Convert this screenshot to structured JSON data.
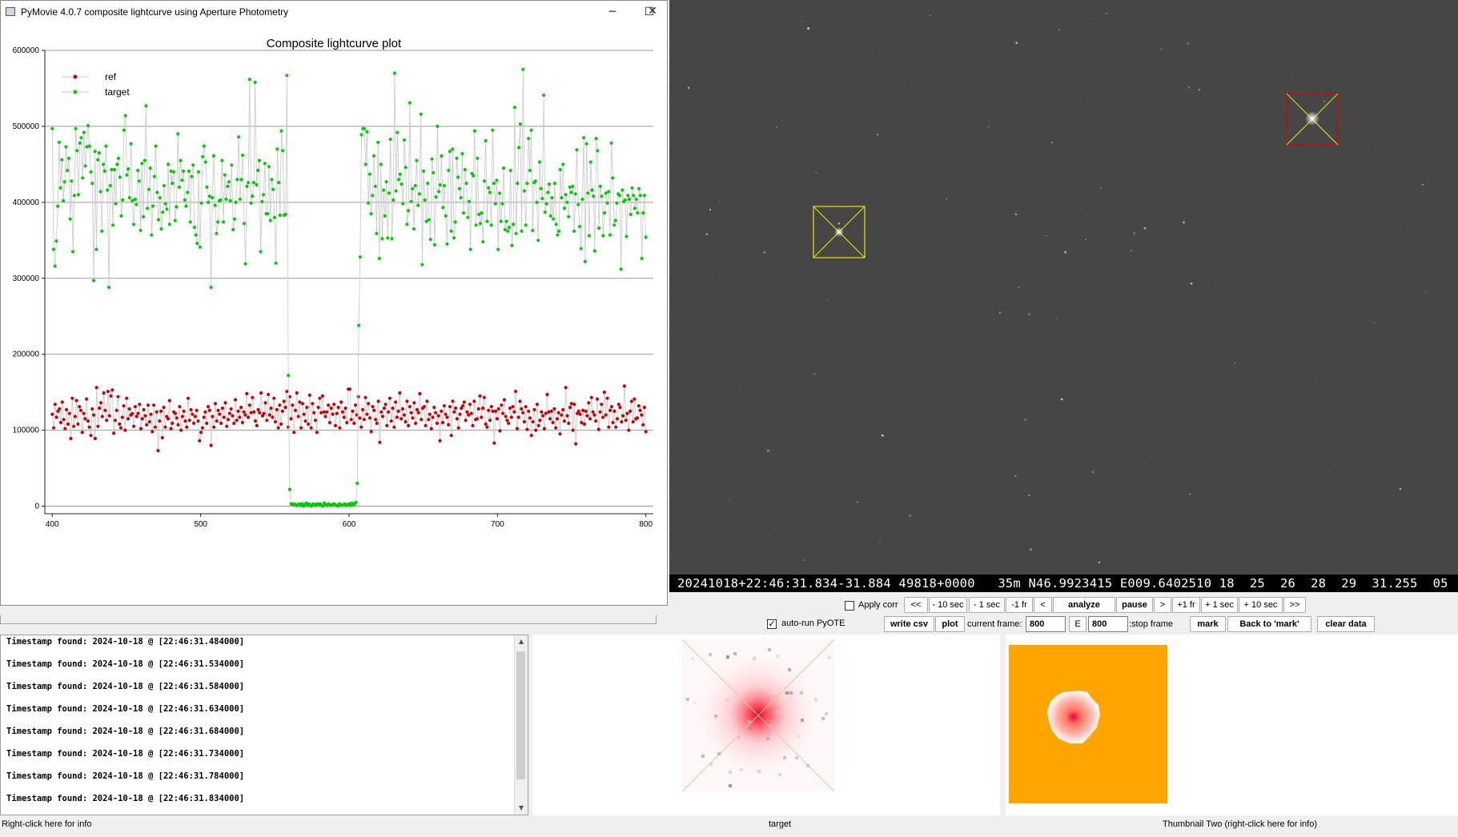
{
  "window": {
    "title": "PyMovie 4.0.7 composite lightcurve using Aperture Photometry",
    "minimize_glyph": "─",
    "maximize_glyph": "☐",
    "close_glyph": "✕"
  },
  "chart_data": {
    "type": "scatter",
    "title": "Composite lightcurve plot",
    "xlabel": "",
    "ylabel": "",
    "xlim": [
      395,
      805
    ],
    "ylim": [
      -10000,
      600000
    ],
    "x_ticks": [
      "400",
      "500",
      "600",
      "700",
      "800"
    ],
    "y_ticks": [
      "0",
      "100000",
      "200000",
      "300000",
      "400000",
      "500000",
      "600000"
    ],
    "grid": true,
    "legend_position": "top-left",
    "series": [
      {
        "name": "ref",
        "color": "#cc0000",
        "x_start": 400,
        "x_end": 800,
        "values": [
          121000,
          103000,
          134000,
          117000,
          125000,
          128000,
          110000,
          137000,
          114000,
          102000,
          127000,
          108000,
          122000,
          89000,
          142000,
          105000,
          118000,
          139000,
          108000,
          131000,
          126000,
          97000,
          122000,
          115000,
          141000,
          112000,
          104000,
          93000,
          128000,
          120000,
          89000,
          156000,
          105000,
          129000,
          136000,
          118000,
          149000,
          126000,
          113000,
          151000,
          119000,
          145000,
          153000,
          96000,
          113000,
          126000,
          144000,
          108000,
          103000,
          117000,
          132000,
          100000,
          142000,
          115000,
          128000,
          120000,
          122000,
          105000,
          131000,
          118000,
          122000,
          134000,
          102000,
          115000,
          127000,
          119000,
          107000,
          133000,
          111000,
          121000,
          98000,
          133000,
          104000,
          124000,
          73000,
          112000,
          125000,
          90000,
          130000,
          104000,
          118000,
          115000,
          139000,
          102000,
          109000,
          124000,
          122000,
          116000,
          107000,
          131000,
          100000,
          118000,
          125000,
          112000,
          104000,
          142000,
          113000,
          127000,
          121000,
          109000,
          118000,
          126000,
          112000,
          86000,
          97000,
          103000,
          117000,
          124000,
          109000,
          131000,
          126000,
          80000,
          118000,
          104000,
          135000,
          112000,
          126000,
          121000,
          109000,
          129000,
          117000,
          136000,
          105000,
          114000,
          122000,
          128000,
          119000,
          109000,
          140000,
          113000,
          125000,
          117000,
          130000,
          110000,
          124000,
          120000,
          148000,
          117000,
          133000,
          123000,
          143000,
          124000,
          112000,
          106000,
          127000,
          123000,
          149000,
          119000,
          122000,
          136000,
          113000,
          147000,
          120000,
          129000,
          117000,
          142000,
          111000,
          127000,
          103000,
          133000,
          108000,
          125000,
          138000,
          130000,
          151000,
          104000,
          144000,
          115000,
          133000,
          97000,
          126000,
          149000,
          118000,
          137000,
          103000,
          135000,
          121000,
          112000,
          130000,
          108000,
          146000,
          103000,
          135000,
          123000,
          113000,
          97000,
          130000,
          142000,
          123000,
          145000,
          124000,
          118000,
          124000,
          133000,
          110000,
          129000,
          121000,
          134000,
          106000,
          122000,
          130000,
          103000,
          137000,
          124000,
          117000,
          129000,
          110000,
          154000,
          154000,
          114000,
          125000,
          109000,
          133000,
          120000,
          144000,
          116000,
          104000,
          127000,
          114000,
          143000,
          121000,
          135000,
          116000,
          98000,
          131000,
          126000,
          114000,
          109000,
          138000,
          84000,
          124000,
          118000,
          129000,
          134000,
          106000,
          124000,
          142000,
          112000,
          129000,
          104000,
          137000,
          117000,
          125000,
          149000,
          115000,
          128000,
          120000,
          111000,
          138000,
          106000,
          131000,
          123000,
          116000,
          136000,
          109000,
          127000,
          123000,
          148000,
          114000,
          129000,
          131000,
          106000,
          138000,
          114000,
          121000,
          102000,
          117000,
          130000,
          123000,
          109000,
          119000,
          86000,
          125000,
          110000,
          132000,
          121000,
          117000,
          107000,
          131000,
          93000,
          138000,
          124000,
          129000,
          115000,
          103000,
          121000,
          129000,
          132000,
          137000,
          113000,
          124000,
          120000,
          134000,
          122000,
          106000,
          138000,
          114000,
          115000,
          128000,
          145000,
          117000,
          129000,
          143000,
          108000,
          104000,
          126000,
          113000,
          131000,
          125000,
          83000,
          125000,
          115000,
          128000,
          99000,
          133000,
          122000,
          140000,
          118000,
          113000,
          109000,
          129000,
          117000,
          131000,
          124000,
          151000,
          102000,
          117000,
          138000,
          128000,
          123000,
          111000,
          131000,
          101000,
          125000,
          116000,
          93000,
          111000,
          127000,
          100000,
          134000,
          106000,
          113000,
          124000,
          119000,
          102000,
          122000,
          147000,
          124000,
          115000,
          125000,
          110000,
          128000,
          103000,
          115000,
          123000,
          95000,
          120000,
          127000,
          112000,
          156000,
          119000,
          109000,
          130000,
          135000,
          100000,
          134000,
          82000,
          122000,
          125000,
          121000,
          110000,
          126000,
          108000,
          125000,
          119000,
          136000,
          115000,
          143000,
          124000,
          120000,
          112000,
          141000,
          101000,
          124000,
          134000,
          117000,
          150000,
          120000,
          142000,
          104000,
          126000,
          131000,
          110000,
          125000,
          104000,
          115000,
          134000,
          130000,
          111000,
          119000,
          158000,
          113000,
          122000,
          100000,
          125000,
          138000,
          111000,
          141000,
          115000,
          116000,
          132000,
          126000,
          120000,
          107000,
          130000,
          98000
        ]
      },
      {
        "name": "target",
        "color": "#00cc00",
        "x_start": 400,
        "x_end": 800,
        "values": [
          497000,
          338000,
          316000,
          349000,
          395000,
          479000,
          419000,
          456000,
          402000,
          427000,
          473000,
          442000,
          458000,
          378000,
          428000,
          335000,
          409000,
          497000,
          468000,
          410000,
          478000,
          485000,
          432000,
          492000,
          448000,
          473000,
          501000,
          474000,
          440000,
          425000,
          297000,
          467000,
          338000,
          456000,
          465000,
          414000,
          362000,
          450000,
          441000,
          474000,
          416000,
          288000,
          422000,
          443000,
          370000,
          443000,
          398000,
          450000,
          458000,
          433000,
          382000,
          403000,
          495000,
          514000,
          436000,
          444000,
          406000,
          477000,
          402000,
          371000,
          404000,
          397000,
          442000,
          428000,
          363000,
          451000,
          381000,
          455000,
          527000,
          392000,
          417000,
          445000,
          357000,
          395000,
          434000,
          474000,
          413000,
          377000,
          406000,
          365000,
          387000,
          422000,
          398000,
          391000,
          450000,
          371000,
          441000,
          425000,
          440000,
          376000,
          394000,
          490000,
          420000,
          455000,
          429000,
          441000,
          403000,
          395000,
          413000,
          441000,
          374000,
          434000,
          449000,
          367000,
          357000,
          346000,
          440000,
          341000,
          399000,
          460000,
          474000,
          453000,
          420000,
          400000,
          408000,
          288000,
          406000,
          461000,
          396000,
          359000,
          374000,
          402000,
          403000,
          455000,
          374000,
          436000,
          404000,
          421000,
          427000,
          402000,
          449000,
          364000,
          378000,
          400000,
          430000,
          486000,
          404000,
          430000,
          462000,
          372000,
          319000,
          421000,
          426000,
          562000,
          399000,
          408000,
          426000,
          558000,
          423000,
          442000,
          455000,
          335000,
          401000,
          410000,
          451000,
          385000,
          385000,
          447000,
          376000,
          430000,
          417000,
          380000,
          320000,
          470000,
          426000,
          383000,
          494000,
          468000,
          383000,
          384000,
          567000,
          172000,
          22000,
          3000,
          2000,
          3000,
          2000,
          1000,
          2000,
          3000,
          1000,
          3000,
          0,
          2000,
          4000,
          1000,
          3000,
          1000,
          0,
          3000,
          2000,
          1000,
          3000,
          2000,
          3000,
          1000,
          0,
          4000,
          2000,
          1000,
          3000,
          2000,
          1000,
          2000,
          3000,
          2000,
          1000,
          0,
          3000,
          2000,
          1000,
          2000,
          3000,
          1000,
          2000,
          3000,
          1000,
          4000,
          2000,
          3000,
          5000,
          30000,
          238000,
          328000,
          489000,
          497000,
          497000,
          450000,
          493000,
          399000,
          437000,
          385000,
          409000,
          461000,
          421000,
          359000,
          479000,
          326000,
          450000,
          352000,
          416000,
          382000,
          427000,
          353000,
          412000,
          483000,
          352000,
          403000,
          570000,
          415000,
          492000,
          430000,
          437000,
          424000,
          398000,
          482000,
          446000,
          371000,
          389000,
          531000,
          401000,
          418000,
          365000,
          422000,
          455000,
          396000,
          411000,
          516000,
          318000,
          441000,
          403000,
          375000,
          425000,
          377000,
          351000,
          457000,
          439000,
          344000,
          407000,
          500000,
          414000,
          423000,
          461000,
          393000,
          422000,
          382000,
          345000,
          442000,
          467000,
          362000,
          470000,
          353000,
          374000,
          458000,
          433000,
          418000,
          406000,
          464000,
          386000,
          443000,
          425000,
          380000,
          401000,
          338000,
          438000,
          435000,
          494000,
          370000,
          458000,
          384000,
          372000,
          386000,
          348000,
          428000,
          481000,
          375000,
          419000,
          413000,
          370000,
          495000,
          425000,
          398000,
          429000,
          338000,
          412000,
          375000,
          398000,
          445000,
          364000,
          375000,
          362000,
          367000,
          442000,
          343000,
          371000,
          525000,
          359000,
          425000,
          472000,
          503000,
          362000,
          575000,
          415000,
          370000,
          425000,
          484000,
          442000,
          495000,
          363000,
          426000,
          428000,
          400000,
          350000,
          453000,
          418000,
          405000,
          541000,
          387000,
          398000,
          413000,
          424000,
          382000,
          406000,
          378000,
          425000,
          371000,
          357000,
          362000,
          443000,
          406000,
          450000,
          392000,
          410000,
          400000,
          381000,
          420000,
          413000,
          421000,
          362000,
          411000,
          469000,
          397000,
          368000,
          339000,
          404000,
          485000,
          322000,
          477000,
          412000,
          356000,
          453000,
          416000,
          408000,
          336000,
          484000,
          468000,
          366000,
          421000,
          408000,
          356000,
          386000,
          412000,
          399000,
          414000,
          357000,
          478000,
          432000,
          370000,
          376000,
          399000,
          411000,
          409000,
          312000,
          416000,
          401000,
          403000,
          355000,
          409000,
          404000,
          384000,
          419000,
          409000,
          392000,
          404000,
          386000,
          418000,
          409000,
          326000,
          386000,
          409000,
          354000
        ]
      }
    ]
  },
  "starfield": {
    "osd_text": "20241018+22:46:31.834-31.884 49818+0000   35m N46.9923415 E009.6402510 18  25  26  28  29  31.255  05",
    "background_color": "#3a3a3a",
    "target_aperture_color": "#ffff00",
    "ref_aperture_color": "#ff0000"
  },
  "controls": {
    "apply_corr": {
      "label": "Apply corr",
      "checked": false
    },
    "auto_run": {
      "label": "auto-run PyOTE",
      "checked": true,
      "check_glyph": "✓"
    },
    "nav": [
      "<<",
      "- 10 sec",
      "- 1 sec",
      "-1 fr",
      "<",
      "analyze",
      "pause",
      ">",
      "+1 fr",
      "+ 1 sec",
      "+ 10 sec",
      ">>"
    ],
    "write_csv": "write csv",
    "plot": "plot",
    "current_frame_label": "current frame:",
    "current_frame_value": "800",
    "e_label": "E",
    "stop_frame_value": "800",
    "stop_frame_label": ":stop frame",
    "mark": "mark",
    "back_to_mark": "Back to 'mark'",
    "clear_data": "clear data"
  },
  "log": {
    "lines": [
      "Timestamp found: 2024-10-18 @ [22:46:31.484000]",
      "Timestamp found: 2024-10-18 @ [22:46:31.534000]",
      "Timestamp found: 2024-10-18 @ [22:46:31.584000]",
      "Timestamp found: 2024-10-18 @ [22:46:31.634000]",
      "Timestamp found: 2024-10-18 @ [22:46:31.684000]",
      "Timestamp found: 2024-10-18 @ [22:46:31.734000]",
      "Timestamp found: 2024-10-18 @ [22:46:31.784000]",
      "Timestamp found: 2024-10-18 @ [22:46:31.834000]"
    ],
    "up_glyph": "▲",
    "down_glyph": "▼"
  },
  "status": {
    "left": "Right-click here for info",
    "thumb1": "target",
    "thumb2": "Thumbnail Two (right-click here for info)"
  },
  "thumbnails": {
    "thumb2_background": "#ffa500"
  }
}
